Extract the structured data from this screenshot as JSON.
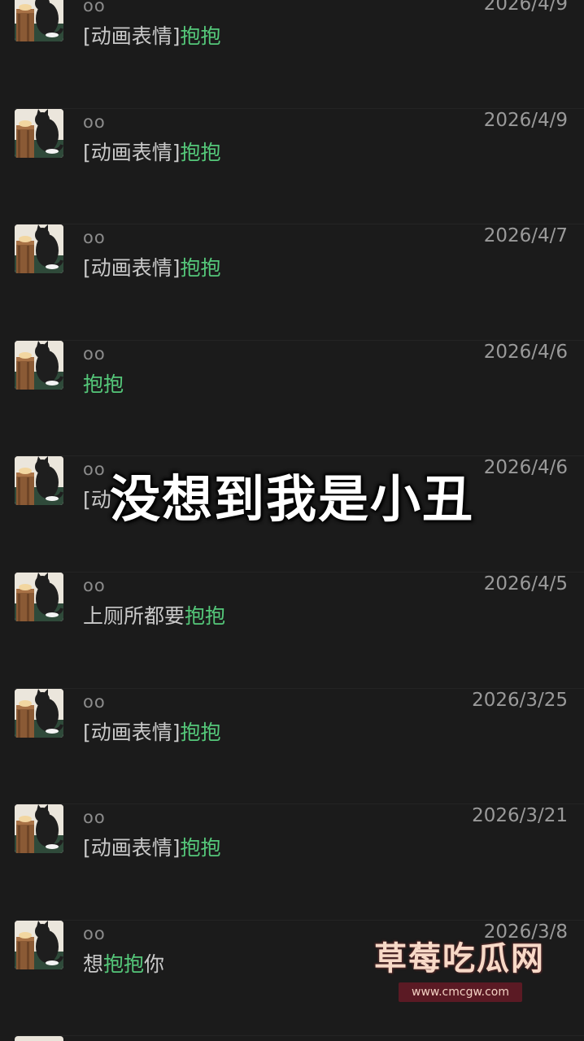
{
  "conversations": [
    {
      "sender": "oo",
      "date": "2026/4/9",
      "preview_plain": "[动画表情]",
      "preview_highlight": "抱抱",
      "preview_tail": ""
    },
    {
      "sender": "oo",
      "date": "2026/4/9",
      "preview_plain": "[动画表情]",
      "preview_highlight": "抱抱",
      "preview_tail": ""
    },
    {
      "sender": "oo",
      "date": "2026/4/7",
      "preview_plain": "[动画表情]",
      "preview_highlight": "抱抱",
      "preview_tail": ""
    },
    {
      "sender": "oo",
      "date": "2026/4/6",
      "preview_plain": "",
      "preview_highlight": "抱抱",
      "preview_tail": ""
    },
    {
      "sender": "oo",
      "date": "2026/4/6",
      "preview_plain": "[动",
      "preview_highlight": "",
      "preview_tail": ""
    },
    {
      "sender": "oo",
      "date": "2026/4/5",
      "preview_plain": "上厕所都要",
      "preview_highlight": "抱抱",
      "preview_tail": ""
    },
    {
      "sender": "oo",
      "date": "2026/3/25",
      "preview_plain": "[动画表情]",
      "preview_highlight": "抱抱",
      "preview_tail": ""
    },
    {
      "sender": "oo",
      "date": "2026/3/21",
      "preview_plain": "[动画表情]",
      "preview_highlight": "抱抱",
      "preview_tail": ""
    },
    {
      "sender": "oo",
      "date": "2026/3/8",
      "preview_plain": "想",
      "preview_highlight": "抱抱",
      "preview_tail": "你"
    }
  ],
  "caption": "没想到我是小丑",
  "watermark": {
    "title": "草莓吃瓜网",
    "url": "www.cmcgw.com"
  },
  "colors": {
    "background": "#1b1b1b",
    "highlight": "#55c87a",
    "text": "#c9c9c9",
    "muted": "#9a9a9a"
  },
  "icons": {
    "avatar": "black-cat-avatar-icon"
  }
}
